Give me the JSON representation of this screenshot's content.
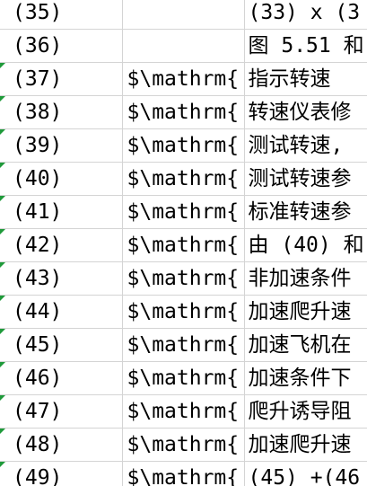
{
  "rows": [
    {
      "a": "(35)",
      "b": "",
      "c": "(33) x (3",
      "marker": false
    },
    {
      "a": "(36)",
      "b": "",
      "c": "图 5.51 和",
      "marker": false
    },
    {
      "a": "(37)",
      "b": "$\\mathrm{",
      "c": "指示转速",
      "marker": true
    },
    {
      "a": "(38)",
      "b": "$\\mathrm{",
      "c": "转速仪表修",
      "marker": true
    },
    {
      "a": "(39)",
      "b": "$\\mathrm{",
      "c": "测试转速,",
      "marker": true
    },
    {
      "a": "(40)",
      "b": "$\\mathrm{",
      "c": "测试转速参",
      "marker": true
    },
    {
      "a": "(41)",
      "b": "$\\mathrm{",
      "c": "标准转速参",
      "marker": true
    },
    {
      "a": "(42)",
      "b": "$\\mathrm{",
      "c": "由 (40) 和",
      "marker": true
    },
    {
      "a": "(43)",
      "b": "$\\mathrm{",
      "c": "非加速条件",
      "marker": true
    },
    {
      "a": "(44)",
      "b": "$\\mathrm{",
      "c": "加速爬升速",
      "marker": true
    },
    {
      "a": "(45)",
      "b": "$\\mathrm{",
      "c": "加速飞机在",
      "marker": true
    },
    {
      "a": "(46)",
      "b": "$\\mathrm{",
      "c": "加速条件下",
      "marker": true
    },
    {
      "a": "(47)",
      "b": "$\\mathrm{",
      "c": "爬升诱导阻",
      "marker": true
    },
    {
      "a": "(48)",
      "b": "$\\mathrm{",
      "c": "加速爬升速",
      "marker": true
    },
    {
      "a": "(49)",
      "b": "$\\mathrm{",
      "c": "(45) +(46",
      "marker": true
    }
  ],
  "colors": {
    "grid_line": "#d4d4d4",
    "comment_marker": "#1f9a3a"
  }
}
